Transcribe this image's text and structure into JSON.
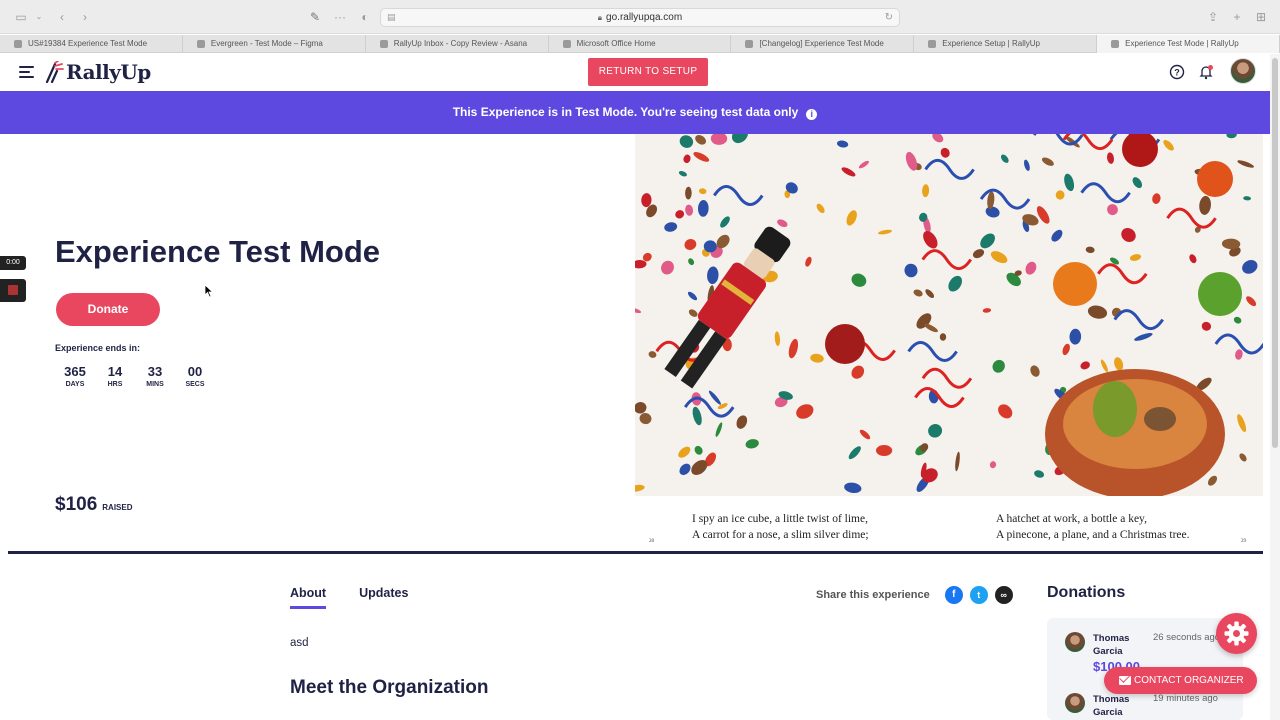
{
  "browser": {
    "url": "go.rallyupqa.com",
    "tabs": [
      {
        "label": "US#19384 Experience Test Mode",
        "active": false
      },
      {
        "label": "Evergreen - Test Mode – Figma",
        "active": false
      },
      {
        "label": "RallyUp Inbox - Copy Review - Asana",
        "active": false
      },
      {
        "label": "Microsoft Office Home",
        "active": false
      },
      {
        "label": "[Changelog] Experience Test Mode",
        "active": false
      },
      {
        "label": "Experience Setup | RallyUp",
        "active": false
      },
      {
        "label": "Experience Test Mode | RallyUp",
        "active": true
      }
    ]
  },
  "header": {
    "logo_text": "RallyUp",
    "return_button": "RETURN TO SETUP"
  },
  "banner": {
    "text": "This Experience is in Test Mode. You're seeing test data only",
    "info_glyph": "i"
  },
  "hero": {
    "title": "Experience Test Mode",
    "donate_label": "Donate",
    "ends_label": "Experience ends in:",
    "countdown": [
      {
        "value": "365",
        "unit": "DAYS"
      },
      {
        "value": "14",
        "unit": "HRS"
      },
      {
        "value": "33",
        "unit": "MINS"
      },
      {
        "value": "00",
        "unit": "SECS"
      }
    ],
    "raised_amount": "$106",
    "raised_label": "RAISED",
    "image_caption_left": [
      "I spy an ice cube, a little twist of lime,",
      "A carrot for a nose, a slim silver dime;"
    ],
    "image_caption_right": [
      "A hatchet at work, a bottle a key,",
      "A pinecone, a plane, and a Christmas tree."
    ],
    "page_left": "28",
    "page_right": "29"
  },
  "recorder": {
    "time": "0:00"
  },
  "content": {
    "tabs": [
      {
        "label": "About",
        "active": true
      },
      {
        "label": "Updates",
        "active": false
      }
    ],
    "share_label": "Share this experience",
    "about_text": "asd",
    "org_title": "Meet the Organization"
  },
  "donations": {
    "title": "Donations",
    "items": [
      {
        "name": "Thomas Garcia",
        "time": "26 seconds ago",
        "amount": "$100.00"
      },
      {
        "name": "Thomas Garcia",
        "time": "19 minutes ago",
        "amount": ""
      }
    ]
  },
  "contact_button": "CONTACT ORGANIZER",
  "colors": {
    "brand": "#e8475f",
    "banner": "#5d49e0",
    "navy": "#1f2244",
    "facebook": "#1877f2",
    "twitter": "#1da1f2"
  }
}
